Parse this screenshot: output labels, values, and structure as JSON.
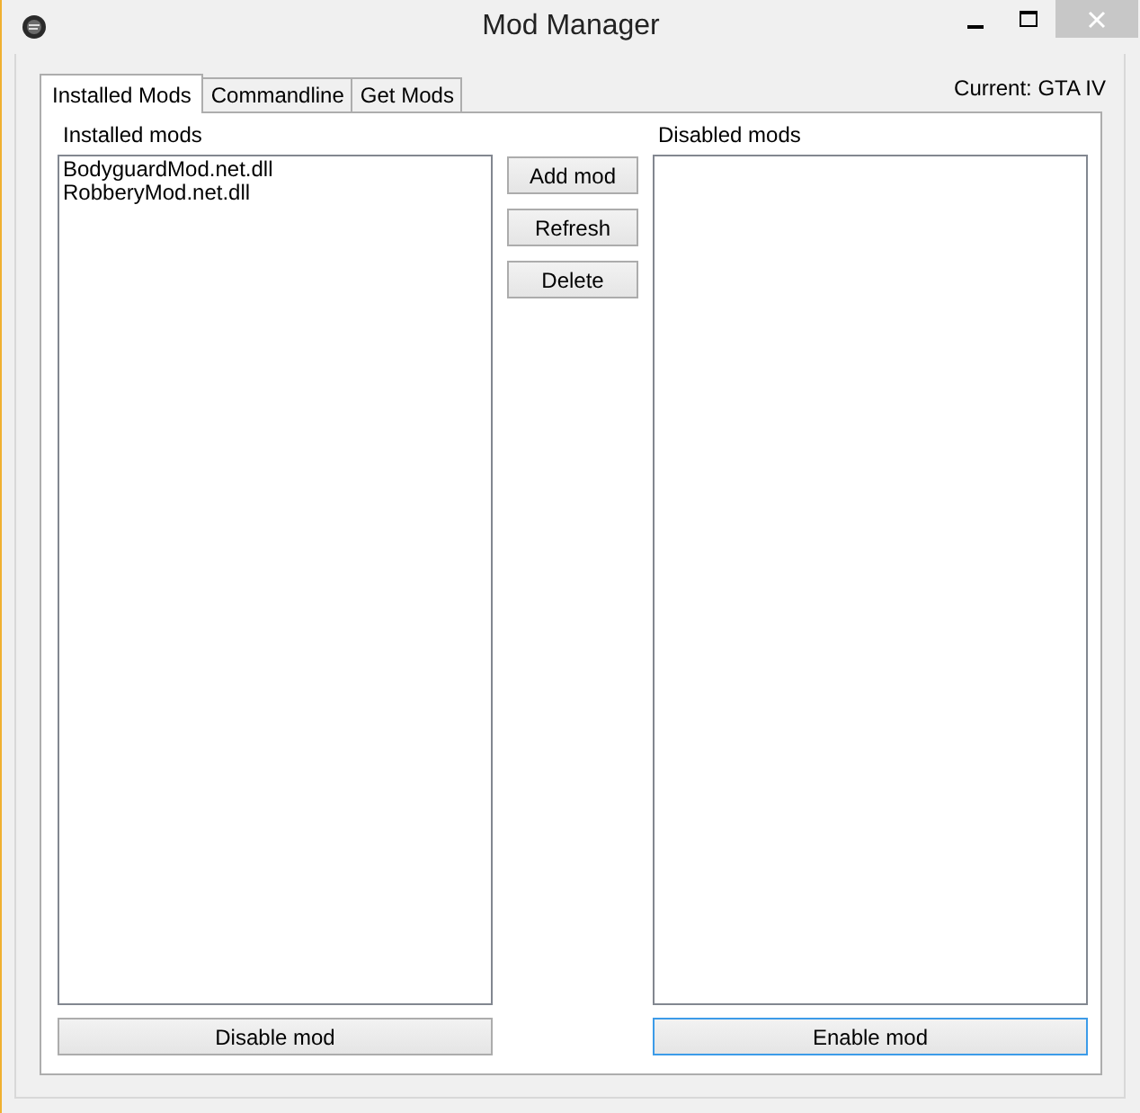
{
  "window": {
    "title": "Mod Manager"
  },
  "tabs": [
    {
      "label": "Installed Mods",
      "selected": true
    },
    {
      "label": "Commandline",
      "selected": false
    },
    {
      "label": "Get Mods",
      "selected": false
    }
  ],
  "current": "Current: GTA IV",
  "installed": {
    "label": "Installed mods",
    "items": [
      "BodyguardMod.net.dll",
      "RobberyMod.net.dll"
    ],
    "button": {
      "label": "Disable mod",
      "focused": false
    }
  },
  "actions": [
    "Add mod",
    "Refresh",
    "Delete"
  ],
  "disabled": {
    "label": "Disabled mods",
    "button": {
      "label": "Enable mod",
      "focused": true
    }
  }
}
